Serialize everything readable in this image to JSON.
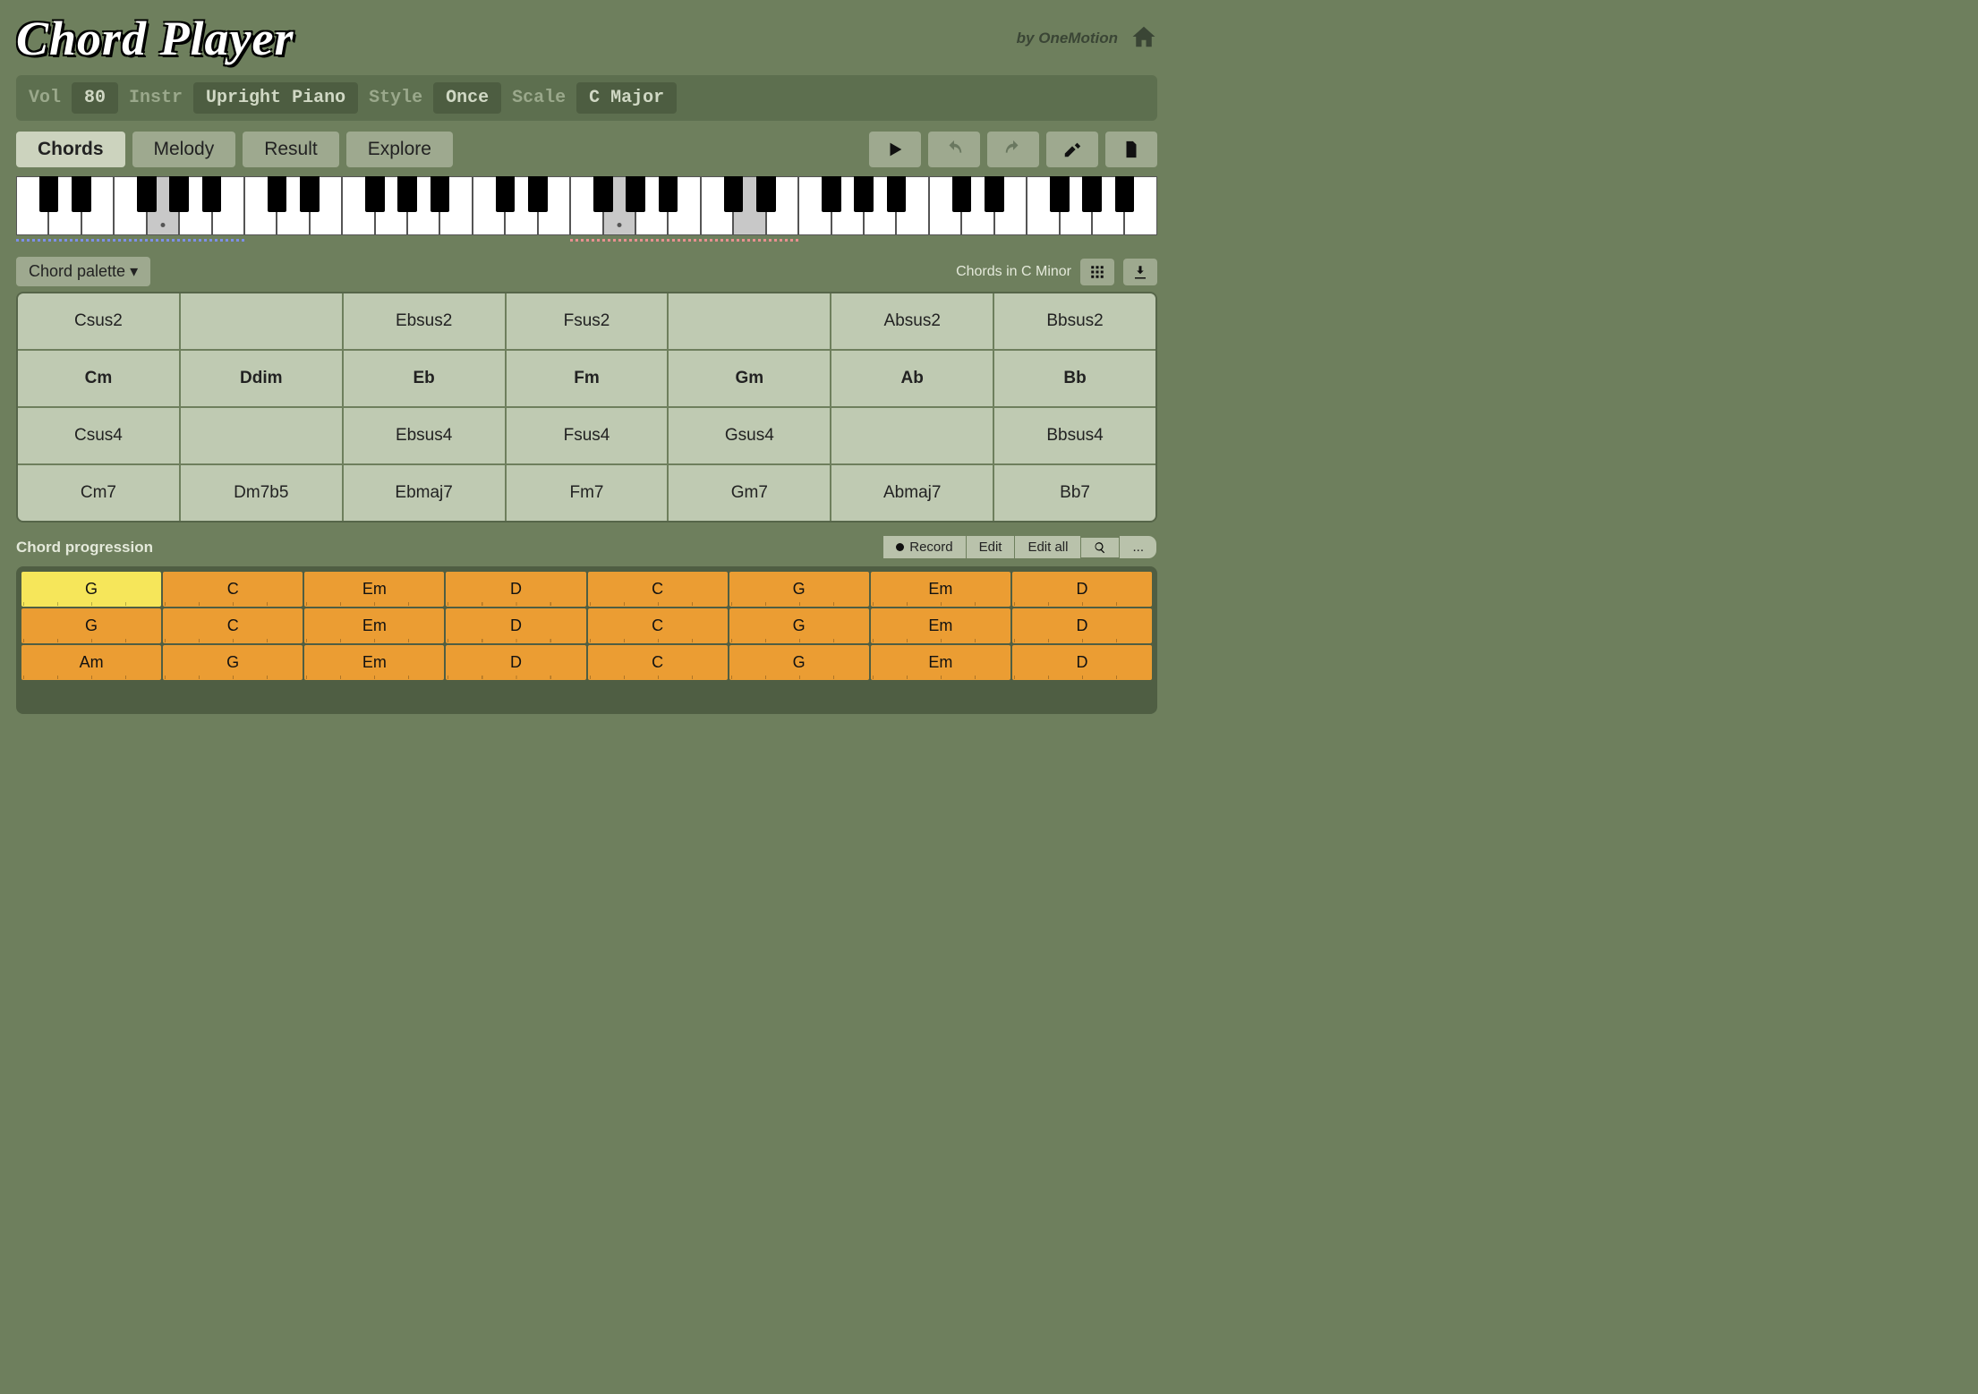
{
  "header": {
    "logo": "Chord Player",
    "byline": "by OneMotion"
  },
  "settings": {
    "vol_label": "Vol",
    "vol_value": "80",
    "instr_label": "Instr",
    "instr_value": "Upright Piano",
    "style_label": "Style",
    "style_value": "Once",
    "scale_label": "Scale",
    "scale_value": "C Major"
  },
  "tabs": [
    "Chords",
    "Melody",
    "Result",
    "Explore"
  ],
  "active_tab": 0,
  "palette": {
    "dropdown_label": "Chord palette ▾",
    "caption": "Chords in C Minor"
  },
  "chord_grid": [
    [
      "Csus2",
      "",
      "Ebsus2",
      "Fsus2",
      "",
      "Absus2",
      "Bbsus2"
    ],
    [
      "Cm",
      "Ddim",
      "Eb",
      "Fm",
      "Gm",
      "Ab",
      "Bb"
    ],
    [
      "Csus4",
      "",
      "Ebsus4",
      "Fsus4",
      "Gsus4",
      "",
      "Bbsus4"
    ],
    [
      "Cm7",
      "Dm7b5",
      "Ebmaj7",
      "Fm7",
      "Gm7",
      "Abmaj7",
      "Bb7"
    ]
  ],
  "chord_grid_bold_row": 1,
  "progression": {
    "title": "Chord progression",
    "buttons": {
      "record": "Record",
      "edit": "Edit",
      "edit_all": "Edit all",
      "more": "..."
    },
    "rows": [
      [
        "G",
        "C",
        "Em",
        "D",
        "C",
        "G",
        "Em",
        "D"
      ],
      [
        "G",
        "C",
        "Em",
        "D",
        "C",
        "G",
        "Em",
        "D"
      ],
      [
        "Am",
        "G",
        "Em",
        "D",
        "C",
        "G",
        "Em",
        "D"
      ]
    ],
    "active": [
      0,
      0
    ]
  },
  "piano": {
    "white_count": 35,
    "pressed_white": [
      4,
      18,
      22
    ],
    "dot_white": [
      4,
      18
    ],
    "black_map": [
      1,
      1,
      0,
      1,
      1,
      1,
      0
    ],
    "ranges": {
      "blue": [
        0,
        7
      ],
      "red": [
        17,
        24
      ]
    }
  }
}
